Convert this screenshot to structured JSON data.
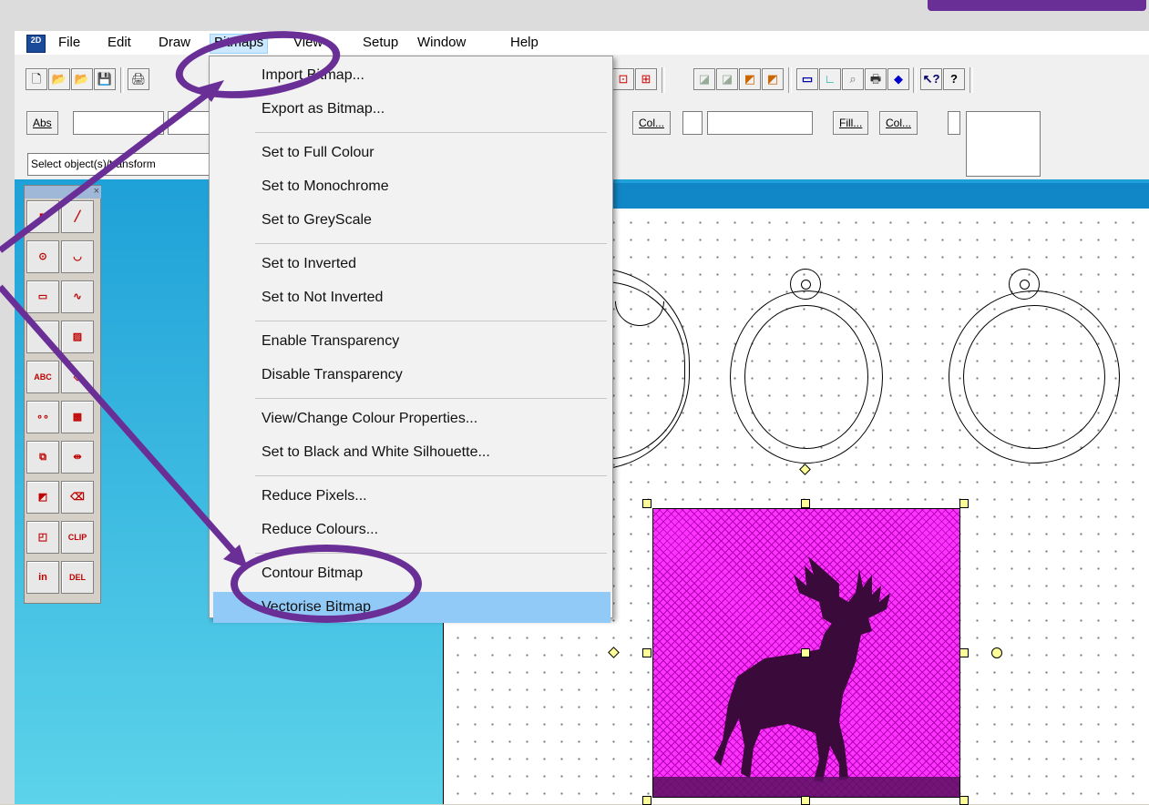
{
  "app": {
    "icon_text": "2D",
    "menu": [
      "File",
      "Edit",
      "Draw",
      "Bitmaps",
      "View",
      "Setup",
      "Window",
      "Help"
    ],
    "active_menu": "Bitmaps"
  },
  "row2": {
    "abs_label": "Abs",
    "col_label_1": "Col...",
    "fill_label": "Fill...",
    "col_label_2": "Col..."
  },
  "status_text": "Select object(s)/transform",
  "toolbox": {
    "close_glyph": "×",
    "tools": [
      {
        "name": "select-tool",
        "glyph": "↖"
      },
      {
        "name": "line-tool",
        "glyph": "╱"
      },
      {
        "name": "circle-radius-tool",
        "glyph": "⊙"
      },
      {
        "name": "arc-tool",
        "glyph": "◡"
      },
      {
        "name": "rectangle-tool",
        "glyph": "▭"
      },
      {
        "name": "curve-tool",
        "glyph": "∿"
      },
      {
        "name": "offset-tool",
        "glyph": "◐"
      },
      {
        "name": "hatch-tool",
        "glyph": "▨"
      },
      {
        "name": "text-tool",
        "glyph": "ABC"
      },
      {
        "name": "rotate-tool",
        "glyph": "◇"
      },
      {
        "name": "points-tool",
        "glyph": "∘∘"
      },
      {
        "name": "fill-pattern-tool",
        "glyph": "▩"
      },
      {
        "name": "group-tool",
        "glyph": "⧉"
      },
      {
        "name": "align-tool",
        "glyph": "⇹"
      },
      {
        "name": "gradient-tool",
        "glyph": "◩"
      },
      {
        "name": "eraser-tool",
        "glyph": "⌫"
      },
      {
        "name": "node-edit-tool",
        "glyph": "◰"
      },
      {
        "name": "clip-tool",
        "glyph": "CLIP"
      },
      {
        "name": "insert-tool",
        "glyph": "in"
      },
      {
        "name": "delete-tool",
        "glyph": "DEL"
      }
    ]
  },
  "bitmaps_menu": {
    "items": [
      {
        "label": "Import Bitmap...",
        "group": 0
      },
      {
        "label": "Export as Bitmap...",
        "group": 0
      },
      {
        "label": "Set to Full Colour",
        "group": 1
      },
      {
        "label": "Set to Monochrome",
        "group": 1
      },
      {
        "label": "Set to GreyScale",
        "group": 1
      },
      {
        "label": "Set to Inverted",
        "group": 2
      },
      {
        "label": "Set to Not Inverted",
        "group": 2
      },
      {
        "label": "Enable Transparency",
        "group": 3
      },
      {
        "label": "Disable Transparency",
        "group": 3
      },
      {
        "label": "View/Change Colour Properties...",
        "group": 4
      },
      {
        "label": "Set to Black and White Silhouette...",
        "group": 4
      },
      {
        "label": "Reduce Pixels...",
        "group": 5
      },
      {
        "label": "Reduce Colours...",
        "group": 5
      },
      {
        "label": "Contour Bitmap",
        "group": 6
      },
      {
        "label": "Vectorise Bitmap",
        "group": 6
      }
    ],
    "highlighted": "Vectorise Bitmap"
  },
  "colors": {
    "annotation": "#6a2f96",
    "highlight": "#91c9f7",
    "bitmap_magenta": "#ff33ff",
    "canvas_header": "#1287c8"
  }
}
